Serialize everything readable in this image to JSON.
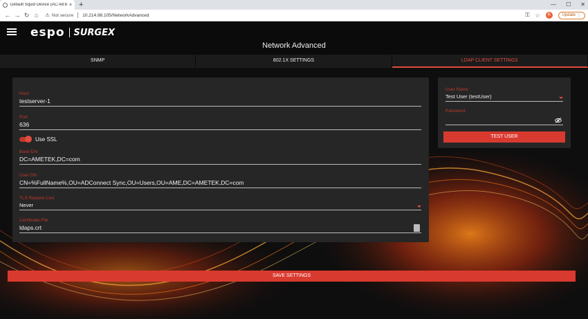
{
  "browser": {
    "tab_title": "Default Squid Device (AC:A8:67:...",
    "tab_close": "×",
    "new_tab": "+",
    "not_secure": "Not secure",
    "url": "10.214.98.105/NetworkAdvanced",
    "avatar_letter": "R",
    "update_label": "Update"
  },
  "app": {
    "logo_espo": "espo",
    "logo_surgex": "SURGEX",
    "page_title": "Network Advanced"
  },
  "tabs": [
    {
      "label": "SNMP",
      "active": false
    },
    {
      "label": "802.1X SETTINGS",
      "active": false
    },
    {
      "label": "LDAP CLIENT SETTINGS",
      "active": true
    }
  ],
  "ldap": {
    "host": {
      "label": "Host",
      "value": "testserver-1"
    },
    "port": {
      "label": "Port",
      "value": "636"
    },
    "use_ssl": {
      "label": "Use SSL",
      "checked": true
    },
    "base_dn": {
      "label": "Base DN",
      "value": "DC=AMETEK,DC=com"
    },
    "user_dn": {
      "label": "User DN",
      "value": "CN=%FullName%,OU=ADConnect Sync,OU=Users,OU=AME,DC=AMETEK,DC=com"
    },
    "tls_require_cert": {
      "label": "TLS Require Cert",
      "value": "Never"
    },
    "certificate_file": {
      "label": "Certificate File",
      "value": "ldaps.crt"
    }
  },
  "test_user": {
    "user_name": {
      "label": "User Name",
      "value": "Test User (testUser)"
    },
    "password": {
      "label": "Password",
      "value": ""
    },
    "button_label": "TEST USER"
  },
  "save_label": "SAVE SETTINGS",
  "colors": {
    "accent": "#d93a2f",
    "card": "#262626",
    "background": "#0e0e0e"
  }
}
